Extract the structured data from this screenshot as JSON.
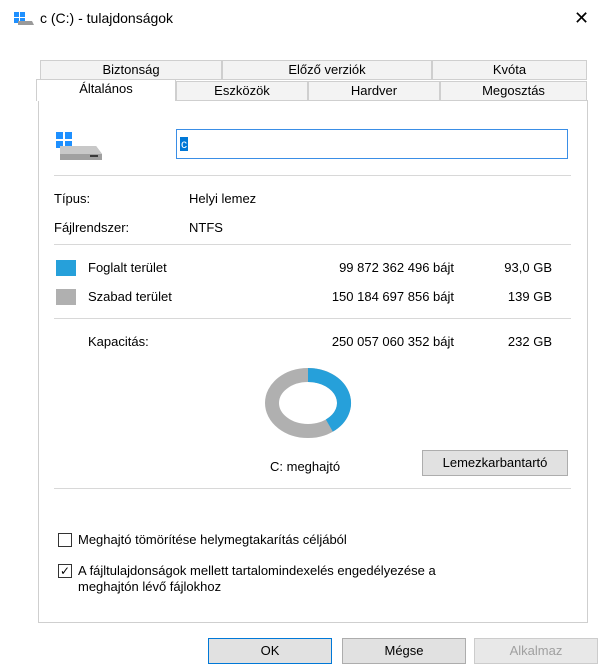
{
  "window": {
    "title": "c (C:) - tulajdonságok",
    "close_glyph": "✕"
  },
  "tabs": {
    "row1": [
      "Biztonság",
      "Előző verziók",
      "Kvóta"
    ],
    "row2": [
      "Általános",
      "Eszközök",
      "Hardver",
      "Megosztás"
    ],
    "active": "Általános"
  },
  "general": {
    "drive_name": "c",
    "type_label": "Típus:",
    "type_value": "Helyi lemez",
    "fs_label": "Fájlrendszer:",
    "fs_value": "NTFS",
    "used": {
      "label": "Foglalt terület",
      "bytes": "99 872 362 496 bájt",
      "size": "93,0 GB",
      "color": "#26a0da"
    },
    "free": {
      "label": "Szabad terület",
      "bytes": "150 184 697 856 bájt",
      "size": "139 GB",
      "color": "#b0b0b0"
    },
    "capacity": {
      "label": "Kapacitás:",
      "bytes": "250 057 060 352 bájt",
      "size": "232 GB"
    },
    "used_fraction": 0.399,
    "drive_caption": "C: meghajtó",
    "cleanup_button": "Lemezkarbantartó",
    "compress_checkbox": {
      "label": "Meghajtó tömörítése helymegtakarítás céljából",
      "checked": false
    },
    "index_checkbox": {
      "label_line1": "A fájltulajdonságok mellett tartalomindexelés engedélyezése a",
      "label_line2": "meghajtón lévő fájlokhoz",
      "checked": true,
      "check_glyph": "✓"
    }
  },
  "buttons": {
    "ok": "OK",
    "cancel": "Mégse",
    "apply": "Alkalmaz"
  }
}
